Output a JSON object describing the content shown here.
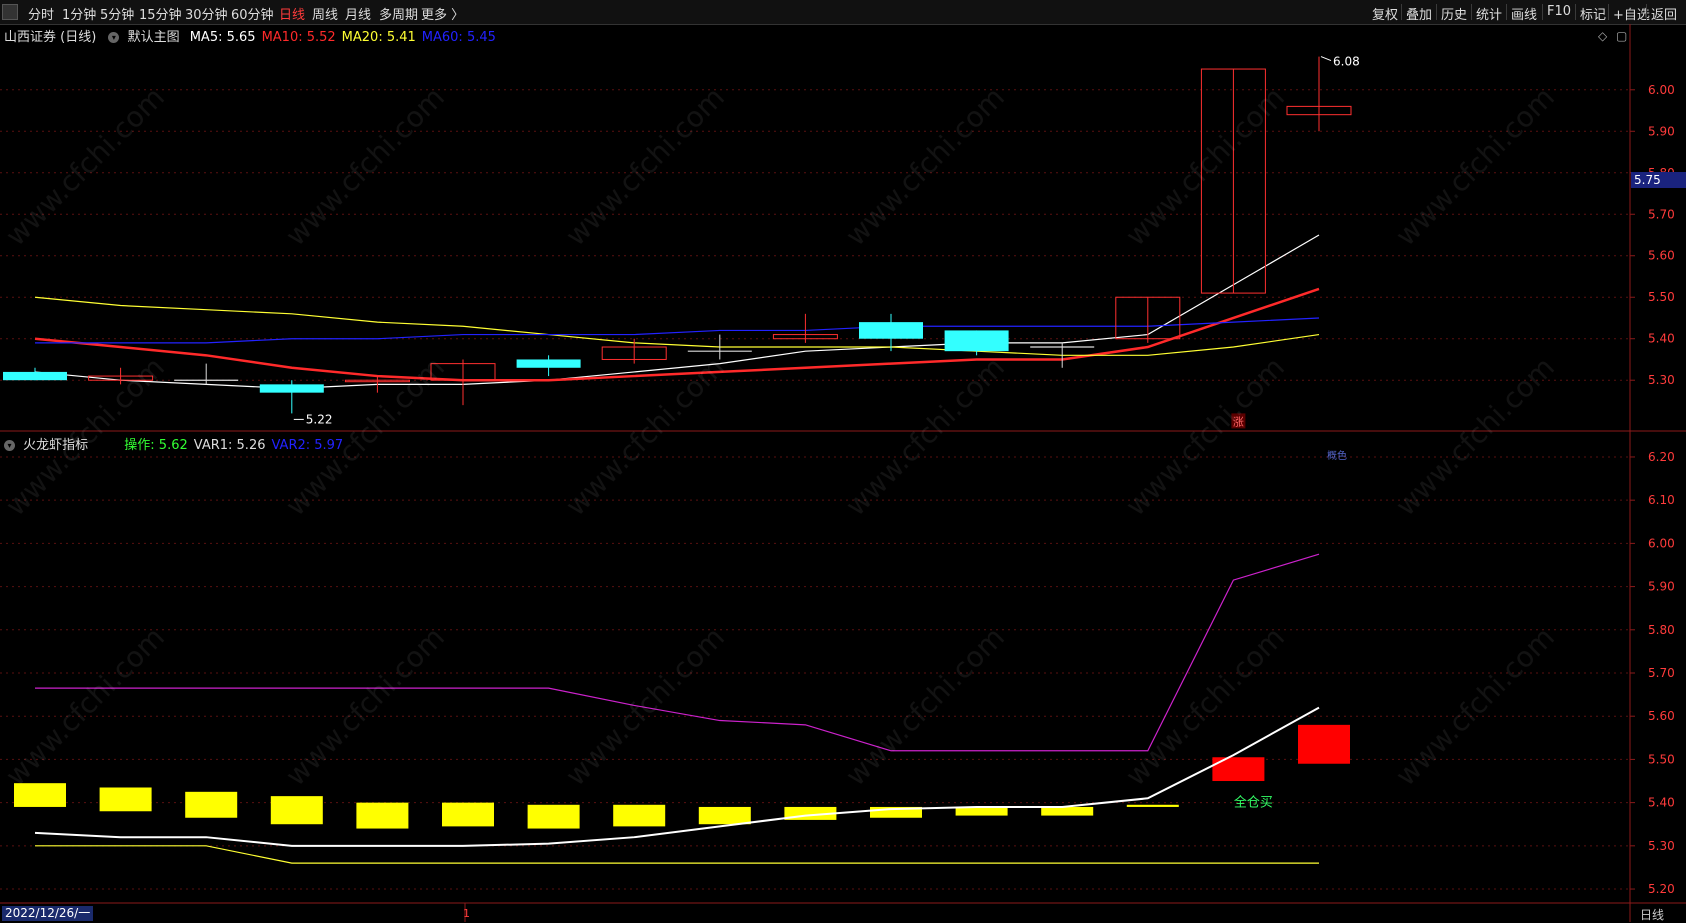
{
  "toolbar": {
    "left_items": [
      "分时",
      "1分钟",
      "5分钟",
      "15分钟",
      "30分钟",
      "60分钟",
      "日线",
      "周线",
      "月线",
      "多周期",
      "更多 〉"
    ],
    "active": "日线",
    "right_items": [
      "复权",
      "叠加",
      "历史",
      "统计",
      "画线",
      "F10",
      "标记",
      "+自选",
      "返回"
    ]
  },
  "main_panel": {
    "stock_name": "山西证券 (日线)",
    "chart_name": "默认主图",
    "ma": [
      {
        "label": "MA5: 5.65",
        "color": "#ffffff"
      },
      {
        "label": "MA10: 5.52",
        "color": "#ff2a2a"
      },
      {
        "label": "MA20: 5.41",
        "color": "#ffff33"
      },
      {
        "label": "MA60: 5.45",
        "color": "#2222ff"
      }
    ],
    "current_price_tag": "5.75",
    "zhang_label": "涨",
    "max_annotation": "6.08",
    "min_annotation": "5.22"
  },
  "sub_panel": {
    "indicator_name": "火龙虾指标",
    "values": [
      {
        "label": "操作: 5.62",
        "color": "#33ff33"
      },
      {
        "label": "VAR1: 5.26",
        "color": "#dddddd"
      },
      {
        "label": "VAR2: 5.97",
        "color": "#2222ff"
      }
    ],
    "signal_text": "全仓买",
    "faint_label": "概色"
  },
  "footer": {
    "date": "2022/12/26/一",
    "marker": "1",
    "period": "日线"
  },
  "watermark_text": "www.cfchi.com",
  "chart_data": [
    {
      "type": "candlestick",
      "title": "",
      "y_ticks": [
        "6.00",
        "5.90",
        "5.80",
        "5.70",
        "5.60",
        "5.50",
        "5.40",
        "5.30"
      ],
      "ylim": [
        5.18,
        6.12
      ],
      "candles": [
        {
          "open": 5.3,
          "close": 5.32,
          "high": 5.33,
          "low": 5.3,
          "up": false
        },
        {
          "open": 5.3,
          "close": 5.31,
          "high": 5.33,
          "low": 5.29,
          "up": true
        },
        {
          "open": 5.3,
          "close": 5.3,
          "high": 5.34,
          "low": 5.29,
          "up": false
        },
        {
          "open": 5.27,
          "close": 5.29,
          "high": 5.3,
          "low": 5.22,
          "up": false
        },
        {
          "open": 5.3,
          "close": 5.3,
          "high": 5.31,
          "low": 5.27,
          "up": true
        },
        {
          "open": 5.3,
          "close": 5.34,
          "high": 5.35,
          "low": 5.24,
          "up": true
        },
        {
          "open": 5.33,
          "close": 5.35,
          "high": 5.36,
          "low": 5.31,
          "up": false
        },
        {
          "open": 5.35,
          "close": 5.38,
          "high": 5.4,
          "low": 5.34,
          "up": true
        },
        {
          "open": 5.37,
          "close": 5.37,
          "high": 5.41,
          "low": 5.35,
          "up": false
        },
        {
          "open": 5.4,
          "close": 5.41,
          "high": 5.46,
          "low": 5.39,
          "up": true
        },
        {
          "open": 5.4,
          "close": 5.44,
          "high": 5.46,
          "low": 5.37,
          "up": false
        },
        {
          "open": 5.37,
          "close": 5.42,
          "high": 5.42,
          "low": 5.36,
          "up": false
        },
        {
          "open": 5.38,
          "close": 5.38,
          "high": 5.39,
          "low": 5.33,
          "up": false
        },
        {
          "open": 5.4,
          "close": 5.5,
          "high": 5.5,
          "low": 5.39,
          "up": true
        },
        {
          "open": 5.51,
          "close": 6.05,
          "high": 6.05,
          "low": 5.51,
          "up": true
        },
        {
          "open": 5.94,
          "close": 5.96,
          "high": 6.08,
          "low": 5.9,
          "up": true
        }
      ],
      "series": [
        {
          "name": "MA5",
          "color": "#ffffff",
          "values": [
            5.32,
            5.3,
            5.29,
            5.28,
            5.29,
            5.29,
            5.3,
            5.32,
            5.34,
            5.37,
            5.38,
            5.39,
            5.39,
            5.41,
            5.53,
            5.65
          ]
        },
        {
          "name": "MA10",
          "color": "#ff2a2a",
          "values": [
            5.4,
            5.38,
            5.36,
            5.33,
            5.31,
            5.3,
            5.3,
            5.31,
            5.32,
            5.33,
            5.34,
            5.35,
            5.35,
            5.38,
            5.45,
            5.52
          ]
        },
        {
          "name": "MA20",
          "color": "#ffff33",
          "values": [
            5.5,
            5.48,
            5.47,
            5.46,
            5.44,
            5.43,
            5.41,
            5.39,
            5.38,
            5.38,
            5.38,
            5.37,
            5.36,
            5.36,
            5.38,
            5.41
          ]
        },
        {
          "name": "MA60",
          "color": "#2222ff",
          "values": [
            5.39,
            5.39,
            5.39,
            5.4,
            5.4,
            5.41,
            5.41,
            5.41,
            5.42,
            5.42,
            5.43,
            5.43,
            5.43,
            5.43,
            5.44,
            5.45
          ]
        }
      ]
    },
    {
      "type": "bar",
      "title": "",
      "y_ticks": [
        "6.20",
        "6.10",
        "6.00",
        "5.90",
        "5.80",
        "5.70",
        "5.60",
        "5.50",
        "5.40",
        "5.30",
        "5.20"
      ],
      "ylim": [
        5.17,
        6.23
      ],
      "yellow_bars": [
        {
          "top": 5.445,
          "bottom": 5.39
        },
        {
          "top": 5.435,
          "bottom": 5.38
        },
        {
          "top": 5.425,
          "bottom": 5.365
        },
        {
          "top": 5.415,
          "bottom": 5.35
        },
        {
          "top": 5.4,
          "bottom": 5.34
        },
        {
          "top": 5.4,
          "bottom": 5.345
        },
        {
          "top": 5.395,
          "bottom": 5.34
        },
        {
          "top": 5.395,
          "bottom": 5.345
        },
        {
          "top": 5.39,
          "bottom": 5.35
        },
        {
          "top": 5.39,
          "bottom": 5.36
        },
        {
          "top": 5.39,
          "bottom": 5.365
        },
        {
          "top": 5.39,
          "bottom": 5.37
        },
        {
          "top": 5.39,
          "bottom": 5.37
        },
        {
          "top": 5.395,
          "bottom": 5.39
        }
      ],
      "red_bars": [
        {
          "index": 14,
          "top": 5.505,
          "bottom": 5.45
        },
        {
          "index": 15,
          "top": 5.58,
          "bottom": 5.49
        }
      ],
      "series": [
        {
          "name": "VAR2",
          "color": "#cc22cc",
          "values": [
            5.665,
            5.665,
            5.665,
            5.665,
            5.665,
            5.665,
            5.665,
            5.625,
            5.59,
            5.58,
            5.52,
            5.52,
            5.52,
            5.52,
            5.915,
            5.975
          ]
        },
        {
          "name": "操作",
          "color": "#ffffff",
          "values": [
            5.33,
            5.32,
            5.32,
            5.3,
            5.3,
            5.3,
            5.305,
            5.32,
            5.345,
            5.37,
            5.385,
            5.39,
            5.39,
            5.41,
            5.51,
            5.62
          ]
        },
        {
          "name": "VAR1",
          "color": "#ffff33",
          "values": [
            5.3,
            5.3,
            5.3,
            5.26,
            5.26,
            5.26,
            5.26,
            5.26,
            5.26,
            5.26,
            5.26,
            5.26,
            5.26,
            5.26,
            5.26,
            5.26
          ]
        }
      ]
    }
  ]
}
